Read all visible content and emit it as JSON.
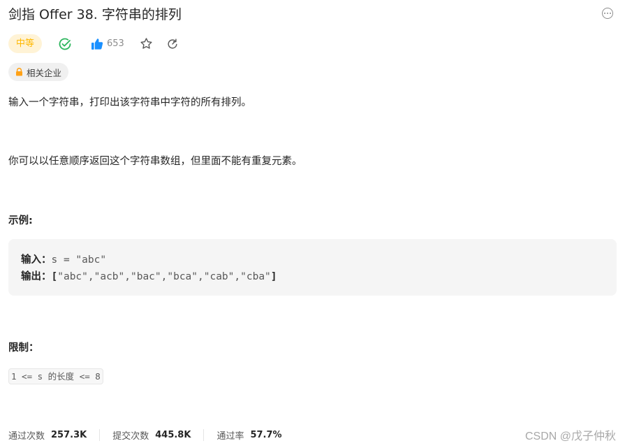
{
  "problem": {
    "title": "剑指 Offer 38. 字符串的排列",
    "difficulty": "中等",
    "likes": "653",
    "company_tag": "相关企业",
    "description": [
      "输入一个字符串，打印出该字符串中字符的所有排列。",
      "你可以以任意顺序返回这个字符串数组，但里面不能有重复元素。"
    ]
  },
  "example": {
    "heading": "示例:",
    "input_label": "输入：",
    "input_value": "s = \"abc\"",
    "output_label": "输出：",
    "output_open": "[",
    "output_value": "\"abc\",\"acb\",\"bac\",\"bca\",\"cab\",\"cba\"",
    "output_close": "]"
  },
  "constraints": {
    "heading": "限制：",
    "items": [
      "1 <= s 的长度 <= 8"
    ]
  },
  "stats": {
    "accepted_label": "通过次数",
    "accepted_value": "257.3K",
    "submissions_label": "提交次数",
    "submissions_value": "445.8K",
    "rate_label": "通过率",
    "rate_value": "57.7%"
  },
  "watermark": "CSDN @戊子仲秋",
  "icons": {
    "more": "more-horizontal-icon",
    "solved": "check-circle-icon",
    "like": "thumbs-up-icon",
    "star": "star-icon",
    "share": "refresh-icon",
    "lock": "lock-icon"
  },
  "colors": {
    "difficulty_bg": "#fff3d6",
    "difficulty_text": "#ffb800",
    "solved_green": "#2db55d",
    "like_blue": "#1a90ff",
    "lock_orange": "#ffa116"
  }
}
